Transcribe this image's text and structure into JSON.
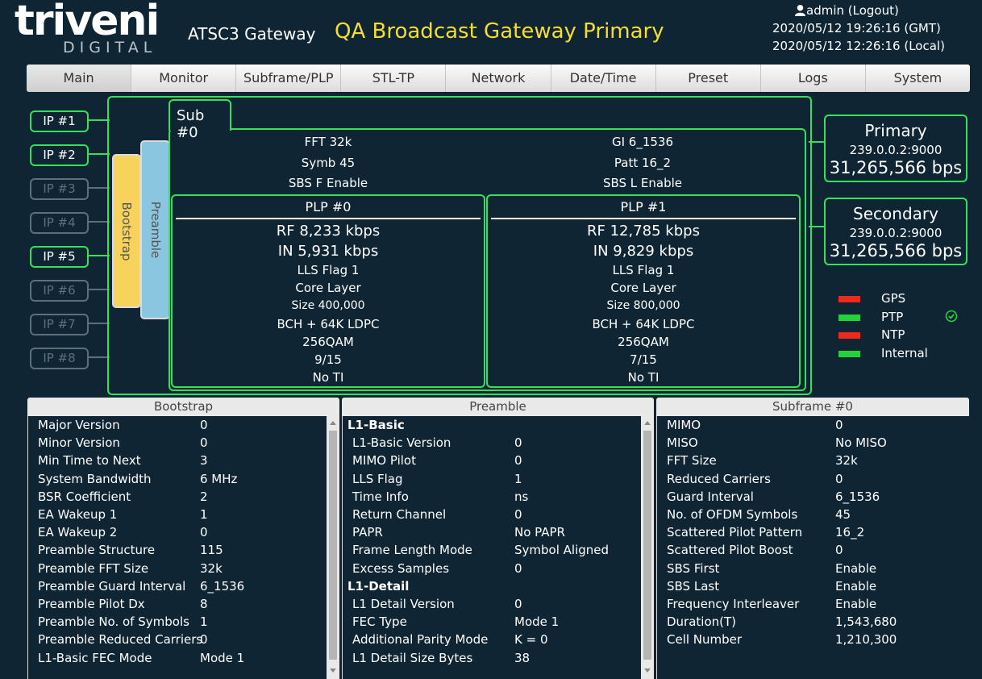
{
  "header": {
    "logo_main": "triveni",
    "logo_sub": "DIGITAL",
    "product": "ATSC3 Gateway",
    "station": "QA Broadcast Gateway Primary",
    "user": "admin (Logout)",
    "time_gmt": "2020/05/12 19:26:16 (GMT)",
    "time_local": "2020/05/12 12:26:16 (Local)"
  },
  "nav": [
    "Main",
    "Monitor",
    "Subframe/PLP",
    "STL-TP",
    "Network",
    "Date/Time",
    "Preset",
    "Logs",
    "System"
  ],
  "inputs": [
    {
      "label": "IP #1",
      "active": true
    },
    {
      "label": "IP #2",
      "active": true
    },
    {
      "label": "IP #3",
      "active": false
    },
    {
      "label": "IP #4",
      "active": false
    },
    {
      "label": "IP #5",
      "active": true
    },
    {
      "label": "IP #6",
      "active": false
    },
    {
      "label": "IP #7",
      "active": false
    },
    {
      "label": "IP #8",
      "active": false
    }
  ],
  "bars": {
    "bootstrap": "Bootstrap",
    "preamble": "Preamble"
  },
  "subframe": {
    "tab": "Sub #0",
    "fft": "FFT 32k",
    "gi": "GI 6_1536",
    "symb": "Symb 45",
    "patt": "Patt 16_2",
    "sbs_f": "SBS F Enable",
    "sbs_l": "SBS L Enable"
  },
  "plps": [
    {
      "title": "PLP #0",
      "rf": "RF 8,233 kbps",
      "in": "IN 5,931 kbps",
      "lls": "LLS Flag 1",
      "layer": "Core Layer",
      "size": "Size 400,000",
      "fec": "BCH + 64K LDPC",
      "mod": "256QAM",
      "cr": "9/15",
      "ti": "No TI"
    },
    {
      "title": "PLP #1",
      "rf": "RF 12,785 kbps",
      "in": "IN 9,829 kbps",
      "lls": "LLS Flag 1",
      "layer": "Core Layer",
      "size": "Size 800,000",
      "fec": "BCH + 64K LDPC",
      "mod": "256QAM",
      "cr": "7/15",
      "ti": "No TI"
    }
  ],
  "outputs": {
    "primary": {
      "title": "Primary",
      "addr": "239.0.0.2:9000",
      "rate": "31,265,566 bps"
    },
    "secondary": {
      "title": "Secondary",
      "addr": "239.0.0.2:9000",
      "rate": "31,265,566 bps"
    }
  },
  "status": [
    {
      "label": "GPS",
      "color": "#ee2a1c"
    },
    {
      "label": "PTP",
      "color": "#23d23a"
    },
    {
      "label": "NTP",
      "color": "#ee2a1c"
    },
    {
      "label": "Internal",
      "color": "#23d23a"
    }
  ],
  "panels": {
    "bootstrap": {
      "title": "Bootstrap",
      "rows": [
        {
          "k": "Major Version",
          "v": "0"
        },
        {
          "k": "Minor Version",
          "v": "0"
        },
        {
          "k": "Min Time to Next",
          "v": "3"
        },
        {
          "k": "System Bandwidth",
          "v": "6 MHz"
        },
        {
          "k": "BSR Coefficient",
          "v": "2"
        },
        {
          "k": "EA Wakeup 1",
          "v": "1"
        },
        {
          "k": "EA Wakeup 2",
          "v": "0"
        },
        {
          "k": "Preamble Structure",
          "v": "115"
        },
        {
          "k": "Preamble FFT Size",
          "v": "32k"
        },
        {
          "k": "Preamble Guard Interval",
          "v": "6_1536"
        },
        {
          "k": "Preamble Pilot Dx",
          "v": "8"
        },
        {
          "k": "Preamble No. of Symbols",
          "v": "1"
        },
        {
          "k": "Preamble Reduced Carriers",
          "v": "0"
        },
        {
          "k": "L1-Basic FEC Mode",
          "v": "Mode 1"
        }
      ]
    },
    "preamble": {
      "title": "Preamble",
      "rows": [
        {
          "section": "L1-Basic"
        },
        {
          "k": "L1-Basic Version",
          "v": "0"
        },
        {
          "k": "MIMO Pilot",
          "v": "0"
        },
        {
          "k": "LLS Flag",
          "v": "1"
        },
        {
          "k": "Time Info",
          "v": "ns"
        },
        {
          "k": "Return Channel",
          "v": "0"
        },
        {
          "k": "PAPR",
          "v": "No PAPR"
        },
        {
          "k": "Frame Length Mode",
          "v": "Symbol Aligned"
        },
        {
          "k": "Excess Samples",
          "v": "0"
        },
        {
          "section": "L1-Detail"
        },
        {
          "k": "L1 Detail Version",
          "v": "0"
        },
        {
          "k": "FEC Type",
          "v": "Mode 1"
        },
        {
          "k": "Additional Parity Mode",
          "v": "K = 0"
        },
        {
          "k": "L1 Detail Size Bytes",
          "v": "38"
        }
      ]
    },
    "subframe": {
      "title": "Subframe #0",
      "rows": [
        {
          "k": "MIMO",
          "v": "0"
        },
        {
          "k": "MISO",
          "v": "No MISO"
        },
        {
          "k": "FFT Size",
          "v": "32k"
        },
        {
          "k": "Reduced Carriers",
          "v": "0"
        },
        {
          "k": "Guard Interval",
          "v": "6_1536"
        },
        {
          "k": "No. of OFDM Symbols",
          "v": "45"
        },
        {
          "k": "Scattered Pilot Pattern",
          "v": "16_2"
        },
        {
          "k": "Scattered Pilot Boost",
          "v": "0"
        },
        {
          "k": "SBS First",
          "v": "Enable"
        },
        {
          "k": "SBS Last",
          "v": "Enable"
        },
        {
          "k": "Frequency Interleaver",
          "v": "Enable"
        },
        {
          "k": "Duration(T)",
          "v": "1,543,680"
        },
        {
          "k": "Cell Number",
          "v": "1,210,300"
        }
      ]
    }
  }
}
